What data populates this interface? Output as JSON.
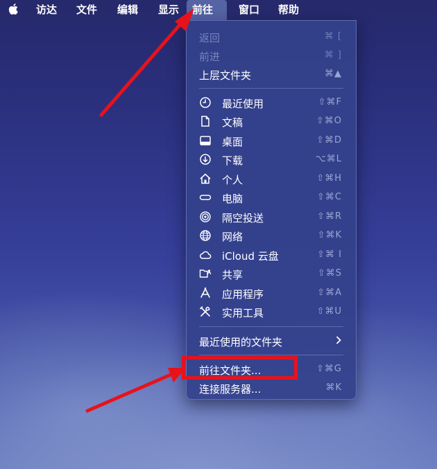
{
  "menubar": {
    "apple_icon": "apple-logo-icon",
    "items": [
      {
        "label": "访达"
      },
      {
        "label": "文件"
      },
      {
        "label": "编辑"
      },
      {
        "label": "显示"
      },
      {
        "label": "前往"
      },
      {
        "label": "窗口"
      },
      {
        "label": "帮助"
      }
    ],
    "active_item": "前往"
  },
  "go_menu": {
    "back": {
      "label": "返回",
      "shortcut": "⌘ [",
      "enabled": false
    },
    "forward": {
      "label": "前进",
      "shortcut": "⌘ ]",
      "enabled": false
    },
    "enclosing_folder": {
      "label": "上层文件夹",
      "shortcut": "⌘▲"
    },
    "locations": [
      {
        "label": "最近使用",
        "shortcut": "⇧⌘F",
        "icon": "clock-icon"
      },
      {
        "label": "文稿",
        "shortcut": "⇧⌘O",
        "icon": "document-icon"
      },
      {
        "label": "桌面",
        "shortcut": "⇧⌘D",
        "icon": "desktop-icon"
      },
      {
        "label": "下载",
        "shortcut": "⌥⌘L",
        "icon": "download-icon"
      },
      {
        "label": "个人",
        "shortcut": "⇧⌘H",
        "icon": "home-icon"
      },
      {
        "label": "电脑",
        "shortcut": "⇧⌘C",
        "icon": "computer-icon"
      },
      {
        "label": "隔空投送",
        "shortcut": "⇧⌘R",
        "icon": "airdrop-icon"
      },
      {
        "label": "网络",
        "shortcut": "⇧⌘K",
        "icon": "network-globe-icon"
      },
      {
        "label": "iCloud 云盘",
        "shortcut": "⇧⌘ I",
        "icon": "cloud-icon"
      },
      {
        "label": "共享",
        "shortcut": "⇧⌘S",
        "icon": "shared-folder-icon"
      },
      {
        "label": "应用程序",
        "shortcut": "⇧⌘A",
        "icon": "applications-icon"
      },
      {
        "label": "实用工具",
        "shortcut": "⇧⌘U",
        "icon": "utilities-tools-icon"
      }
    ],
    "recent_folders": {
      "label": "最近使用的文件夹",
      "icon": "chevron-right-icon"
    },
    "go_to_folder": {
      "label": "前往文件夹...",
      "shortcut": "⇧⌘G"
    },
    "connect_server": {
      "label": "连接服务器...",
      "shortcut": "⌘K"
    }
  },
  "annotations": {
    "color": "#e8121b",
    "highlighted_item": "前往文件夹..."
  }
}
